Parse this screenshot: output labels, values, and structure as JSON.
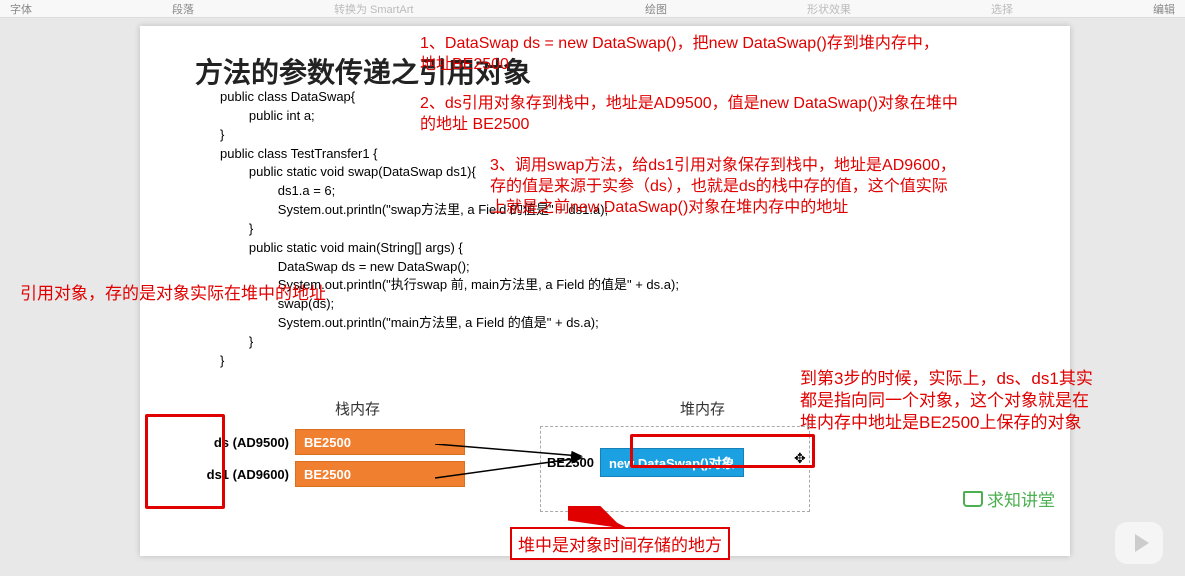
{
  "ribbon": {
    "group1": "字体",
    "group2": "段落",
    "btn_smart": "转换为 SmartArt",
    "group3": "绘图",
    "btn_shape": "形状效果",
    "btn_select": "选择",
    "group4": "编辑"
  },
  "slide": {
    "title": "方法的参数传递之引用对象",
    "code": "public class DataSwap{\n        public int a;\n}\npublic class TestTransfer1 {\n        public static void swap(DataSwap ds1){\n                ds1.a = 6;\n                System.out.println(\"swap方法里, a Field 的值是\" + ds1.a);\n        }\n        public static void main(String[] args) {\n                DataSwap ds = new DataSwap();\n                System.out.println(\"执行swap 前, main方法里, a Field 的值是\" + ds.a);\n                swap(ds);\n                System.out.println(\"main方法里, a Field 的值是\" + ds.a);\n        }\n}"
  },
  "notes": {
    "n1": "1、DataSwap ds = new DataSwap()，把new DataSwap()存到堆内存中，地址BE2500",
    "n2": "2、ds引用对象存到栈中，地址是AD9500，值是new DataSwap()对象在堆中的地址 BE2500",
    "n3": "3、调用swap方法，给ds1引用对象保存到栈中，地址是AD9600，存的值是来源于实参（ds），也就是ds的栈中存的值，这个值实际上就是之前new DataSwap()对象在堆内存中的地址",
    "left": "引用对象，存的是对象实际在堆中的地址",
    "right": "到第3步的时候，实际上，ds、ds1其实都是指向同一个对象，这个对象就是在堆内存中地址是BE2500上保存的对象",
    "caption": "堆中是对象时间存储的地方"
  },
  "mem": {
    "stack_title": "栈内存",
    "heap_title": "堆内存",
    "rows": [
      {
        "lbl": "ds  (AD9500)",
        "val": "BE2500"
      },
      {
        "lbl": "ds1  (AD9600)",
        "val": "BE2500"
      }
    ],
    "heap_addr": "BE2500",
    "heap_val": "new DataSwap()对象"
  },
  "brand": "求知讲堂"
}
